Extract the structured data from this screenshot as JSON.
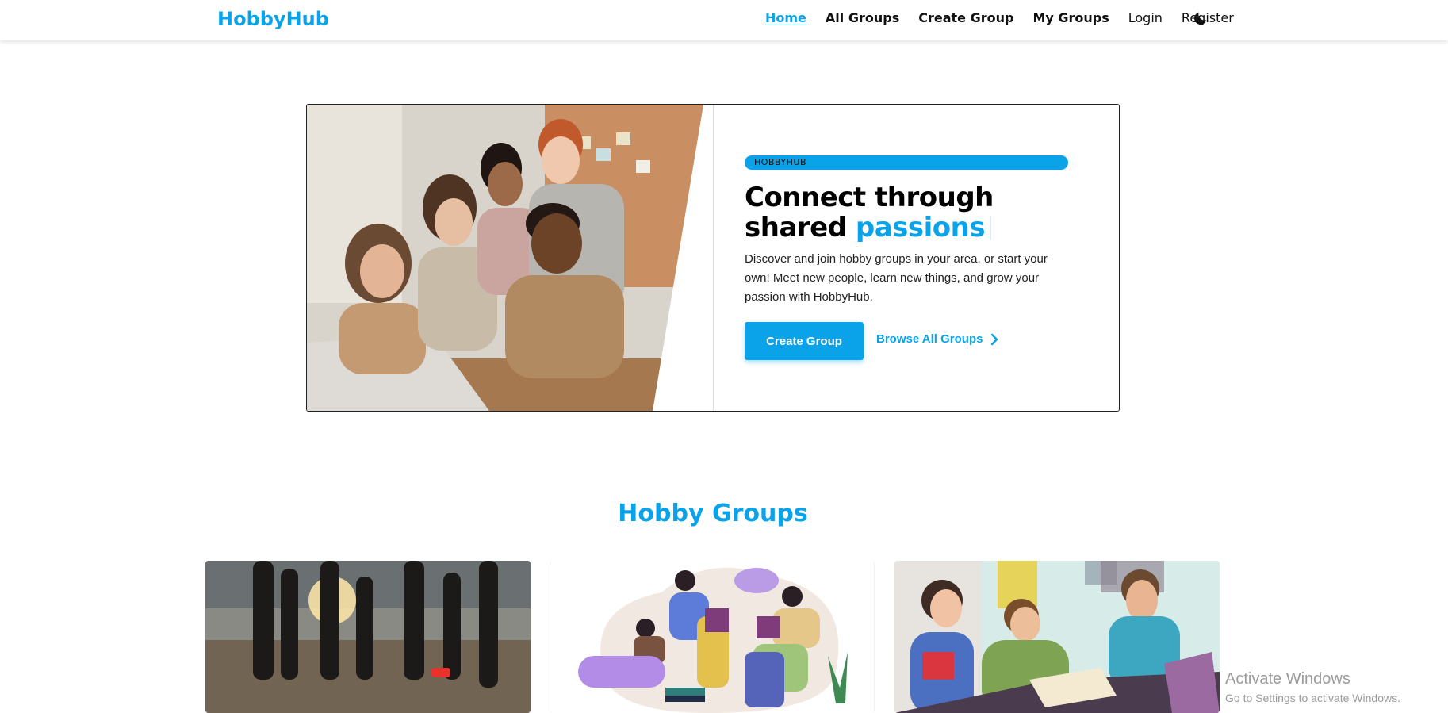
{
  "brand": "HobbyHub",
  "nav": {
    "home": "Home",
    "all_groups": "All Groups",
    "create_group": "Create Group",
    "my_groups": "My Groups",
    "login": "Login",
    "register": "Register",
    "theme_icon": "moon-icon"
  },
  "hero": {
    "badge": "HOBBYHUB",
    "headline_line1": "Connect through",
    "headline_line2_prefix": "shared ",
    "headline_line2_accent": "passions",
    "description": "Discover and join hobby groups in your area, or start your own! Meet new people, learn new things, and grow your passion with HobbyHub.",
    "primary_button": "Create Group",
    "secondary_link": "Browse All Groups",
    "image": "people-around-laptop-photo"
  },
  "section": {
    "title": "Hobby Groups",
    "cards": [
      {
        "image": "runners-at-sunset-photo"
      },
      {
        "image": "book-club-reading-illustration"
      },
      {
        "image": "study-group-illustration"
      }
    ]
  },
  "watermark": {
    "line1": "Activate Windows",
    "line2": "Go to Settings to activate Windows."
  },
  "colors": {
    "accent": "#0aa3ea",
    "text": "#111111",
    "background": "#ffffff"
  }
}
